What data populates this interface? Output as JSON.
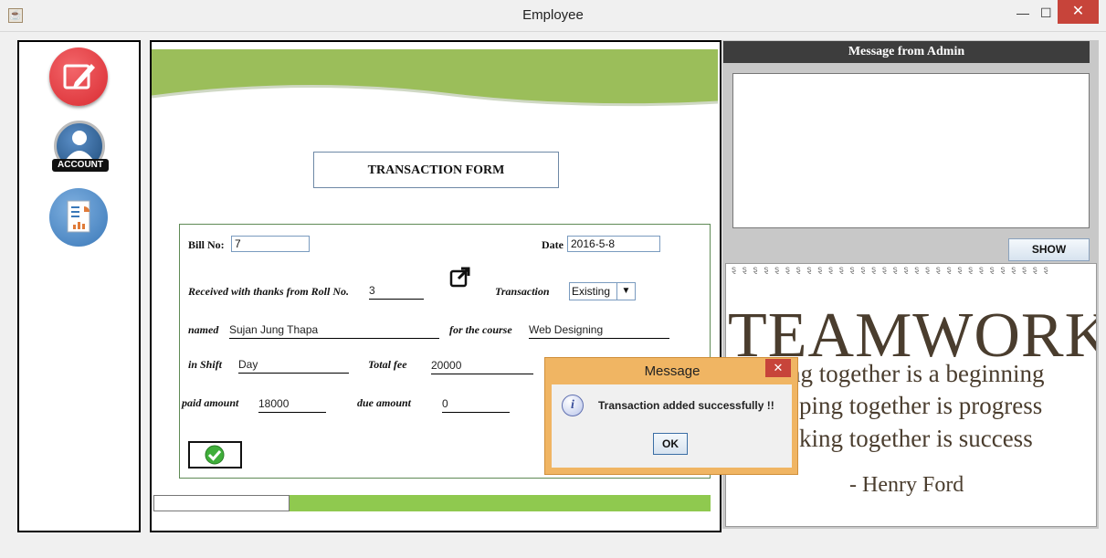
{
  "window": {
    "title": "Employee",
    "minimize_glyph": "—",
    "maximize_glyph": "☐",
    "close_glyph": "✕"
  },
  "sidebar": {
    "items": [
      {
        "icon": "edit-icon",
        "color": "#e0353b"
      },
      {
        "icon": "account-icon",
        "label": "ACCOUNT",
        "color": "#1f4c7a"
      },
      {
        "icon": "report-icon",
        "color": "#4a87c2"
      }
    ]
  },
  "form": {
    "title": "TRANSACTION FORM",
    "bill_no_label": "Bill No:",
    "bill_no_value": "7",
    "date_label": "Date",
    "date_value": "2016-5-8",
    "received_label": "Received with thanks from  Roll No.",
    "roll_no_value": "3",
    "transaction_label": "Transaction",
    "transaction_value": "Existing",
    "named_label": "named",
    "named_value": "Sujan  Jung Thapa",
    "course_label": "for the course",
    "course_value": "Web Designing",
    "shift_label": "in Shift",
    "shift_value": "Day",
    "total_fee_label": "Total fee",
    "total_fee_value": "20000",
    "paid_label": "paid amount",
    "paid_value": "18000",
    "due_label": "due amount",
    "due_value": "0"
  },
  "admin": {
    "header": "Message from Admin",
    "message": "",
    "show_button": "SHOW"
  },
  "poster": {
    "title": "TEAMWORK",
    "line1": "ng together is a beginning",
    "line2": "ping together is progress",
    "line3": "king together is success",
    "author": "- Henry Ford"
  },
  "dialog": {
    "title": "Message",
    "close_glyph": "✕",
    "info_glyph": "i",
    "message": "Transaction added successfully !!",
    "ok_button": "OK"
  },
  "colors": {
    "accent_green": "#8fc94f",
    "dialog_frame": "#f0b563",
    "admin_header": "#3d3d3d"
  }
}
